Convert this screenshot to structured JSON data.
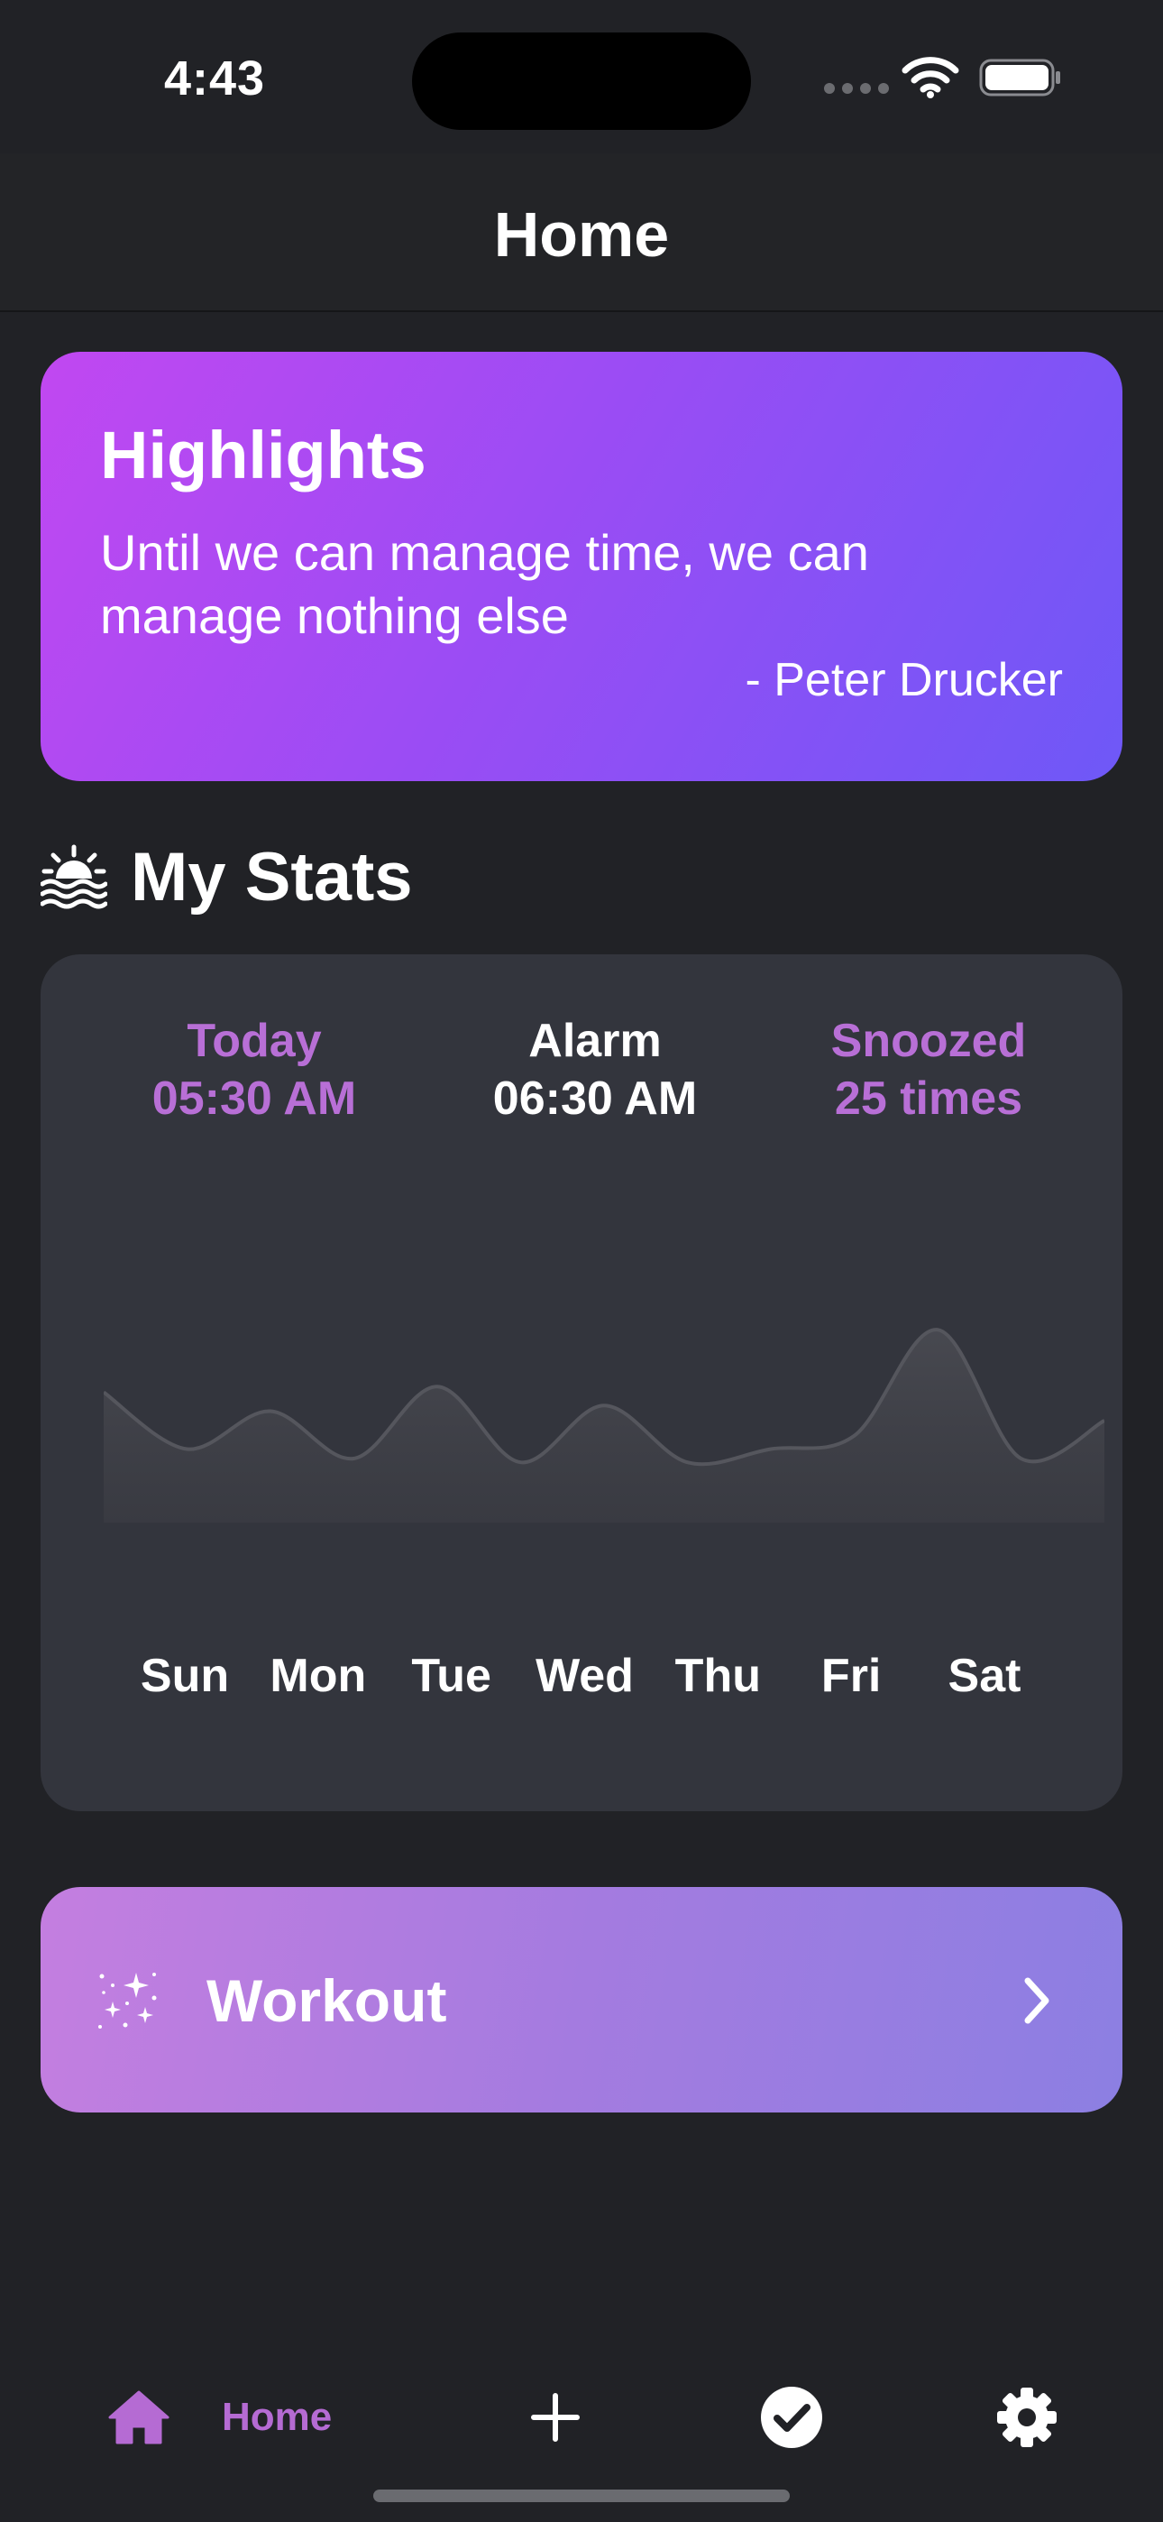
{
  "status_bar": {
    "time": "4:43"
  },
  "header": {
    "title": "Home"
  },
  "highlights": {
    "title": "Highlights",
    "quote": "Until we can manage time, we can manage nothing else",
    "author": "- Peter Drucker"
  },
  "stats": {
    "title": "My Stats",
    "today_label": "Today",
    "today_value": "05:30 AM",
    "alarm_label": "Alarm",
    "alarm_value": "06:30 AM",
    "snoozed_label": "Snoozed",
    "snoozed_value": "25 times",
    "days": [
      "Sun",
      "Mon",
      "Tue",
      "Wed",
      "Thu",
      "Fri",
      "Sat"
    ]
  },
  "chart_data": {
    "type": "area",
    "categories": [
      "Sun",
      "Mon",
      "Tue",
      "Wed",
      "Thu",
      "Fri",
      "Sat"
    ],
    "x": [
      0,
      0.5,
      1,
      1.5,
      2,
      2.5,
      3,
      3.5,
      4,
      4.5,
      5,
      5.5,
      6
    ],
    "values": [
      45,
      15,
      35,
      10,
      48,
      8,
      38,
      8,
      15,
      22,
      78,
      10,
      30
    ],
    "ylim": [
      0,
      100
    ],
    "grid": false
  },
  "workout": {
    "label": "Workout"
  },
  "tab_bar": {
    "home_label": "Home"
  },
  "colors": {
    "background": "#212226",
    "card": "#33353d",
    "accent": "#b86fd6",
    "highlight_start": "#c148f1",
    "highlight_end": "#6e58f7"
  },
  "icons": {
    "sunset": "sunset-icon",
    "sparkles": "sparkles-icon",
    "chevron": "chevron-right-icon",
    "home": "home-icon",
    "add": "plus-icon",
    "done": "checkmark-circle-icon",
    "settings": "gear-icon"
  }
}
